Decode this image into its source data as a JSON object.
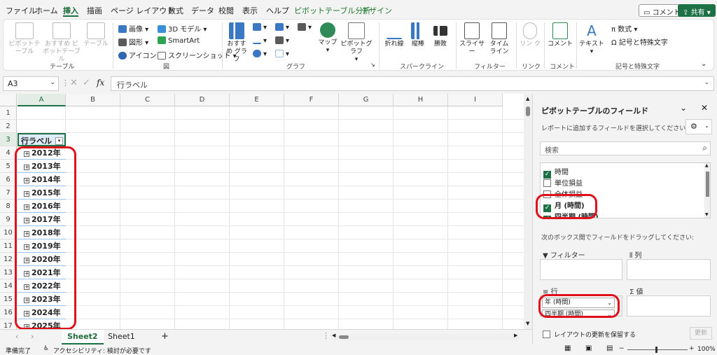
{
  "menu": {
    "file": "ファイル",
    "home": "ホーム",
    "insert": "挿入",
    "draw": "描画",
    "layout": "ページ レイアウト",
    "formula": "数式",
    "data": "データ",
    "review": "校閲",
    "view": "表示",
    "help": "ヘルプ",
    "pivot_analyze": "ピボットテーブル分析",
    "design": "デザイン",
    "comment_btn": "コメント",
    "share_btn": "共有"
  },
  "ribbon": {
    "pivot": "ピボットテーブル",
    "rec_pivot": "おすすめ ピボットテーブル",
    "table": "テーブル",
    "group_table": "テーブル",
    "image": "画像",
    "shapes": "図形",
    "icons": "アイコン",
    "model3d": "3D モデル",
    "smartart": "SmartArt",
    "screenshot": "スクリーンショット",
    "group_fig": "図",
    "rec_charts": "おすすめ グラフ",
    "maps": "マップ",
    "pivot_chart": "ピボットグラフ",
    "group_chart": "グラフ",
    "spark_line": "折れ線",
    "spark_col": "縦棒",
    "spark_wl": "勝敗",
    "group_spark": "スパークライン",
    "slicer": "スライサー",
    "timeline": "タイム ライン",
    "group_filter": "フィルター",
    "link": "リン ク",
    "group_link": "リンク",
    "comment": "コメント",
    "group_comment": "コメント",
    "textbox": "テキスト",
    "equation": "数式",
    "symbol": "記号と特殊文字",
    "group_symbol": "記号と特殊文字"
  },
  "formula_bar": {
    "name_box": "A3",
    "fx": "fx",
    "content": "行ラベル"
  },
  "grid": {
    "columns": [
      "A",
      "B",
      "C",
      "D",
      "E",
      "F",
      "G",
      "H",
      "I"
    ],
    "rows": [
      "1",
      "2",
      "3",
      "4",
      "5",
      "6",
      "7",
      "8",
      "9",
      "10",
      "11",
      "12",
      "13",
      "14",
      "15",
      "16",
      "17"
    ],
    "header_cell": "行ラベル",
    "years": [
      "2012年",
      "2013年",
      "2014年",
      "2015年",
      "2016年",
      "2017年",
      "2018年",
      "2019年",
      "2020年",
      "2021年",
      "2022年",
      "2023年",
      "2024年",
      "2025年"
    ]
  },
  "sheets": {
    "active": "Sheet2",
    "other": "Sheet1",
    "add": "+"
  },
  "status": {
    "ready": "準備完了",
    "accessibility": "アクセシビリティ: 検討が必要です",
    "zoom": "100%"
  },
  "pane": {
    "title": "ピボットテーブルのフィールド",
    "instruction": "レポートに追加するフィールドを選択してください:",
    "search_placeholder": "検索",
    "fields": [
      {
        "label": "時間",
        "checked": true
      },
      {
        "label": "単位損益",
        "checked": false
      },
      {
        "label": "全体損益",
        "checked": false
      },
      {
        "label": "月 (時間)",
        "checked": true
      },
      {
        "label": "四半期 (時間)",
        "checked": true
      }
    ],
    "drag_instruction": "次のボックス間でフィールドをドラッグしてください:",
    "filter_label": "フィルター",
    "columns_label": "列",
    "rows_label": "行",
    "values_label": "値",
    "row_items": [
      "年 (時間)",
      "四半期 (時間)"
    ],
    "defer_label": "レイアウトの更新を保留する",
    "update_btn": "更新"
  },
  "colors": {
    "accent": "#1e7145",
    "highlight": "#e0101a"
  }
}
